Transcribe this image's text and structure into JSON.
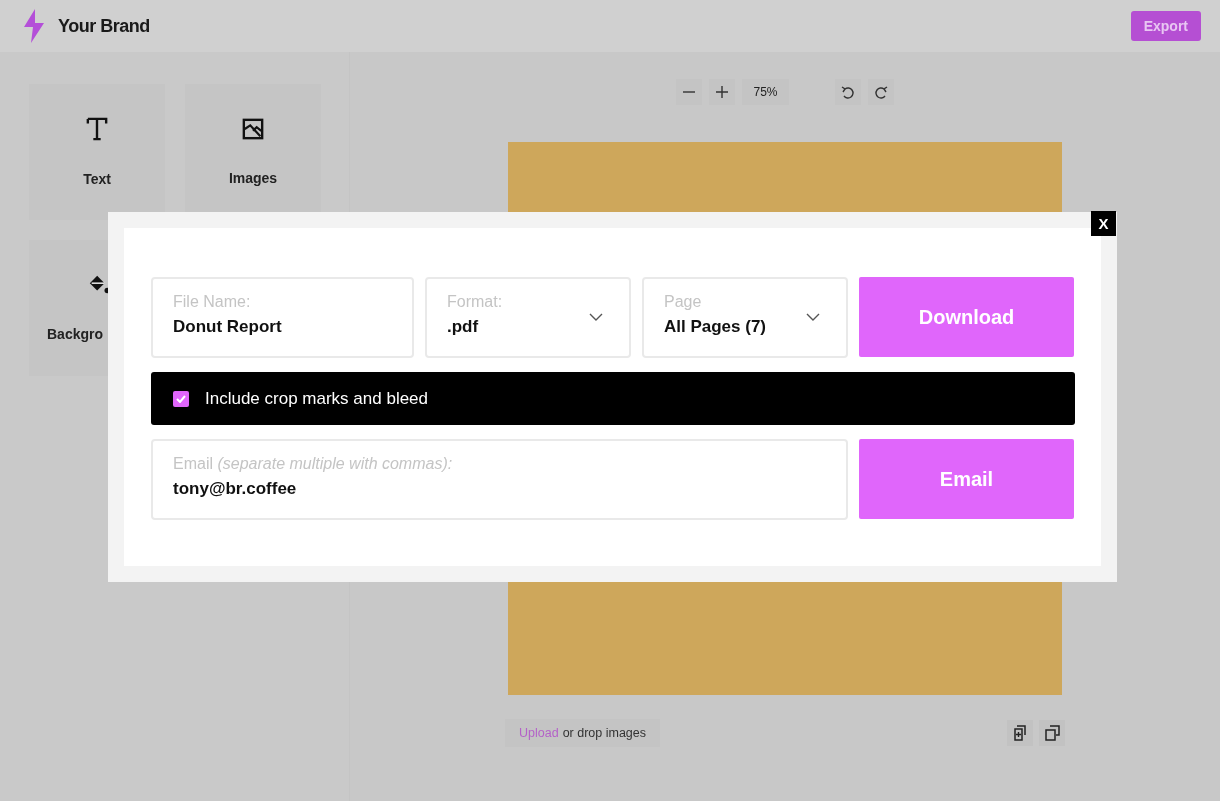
{
  "header": {
    "brand": "Your Brand",
    "export_button": "Export"
  },
  "sidebar": {
    "tiles": [
      {
        "kind": "text",
        "label": "Text"
      },
      {
        "kind": "images",
        "label": "Images"
      },
      {
        "kind": "background",
        "label": "Backgro"
      }
    ]
  },
  "toolbar": {
    "zoom": "75%"
  },
  "upload": {
    "link": "Upload",
    "text": "or drop images"
  },
  "export_dialog": {
    "close": "X",
    "file_name": {
      "label": "File Name:",
      "value": "Donut Report"
    },
    "format": {
      "label": "Format:",
      "value": ".pdf"
    },
    "page": {
      "label": "Page",
      "value": "All Pages (7)"
    },
    "download_button": "Download",
    "crop_marks": {
      "label": "Include crop marks and bleed",
      "checked": true
    },
    "email": {
      "label": "Email *(separate multiple with commas):*",
      "value": "tony@br.coffee"
    },
    "email_button": "Email"
  }
}
